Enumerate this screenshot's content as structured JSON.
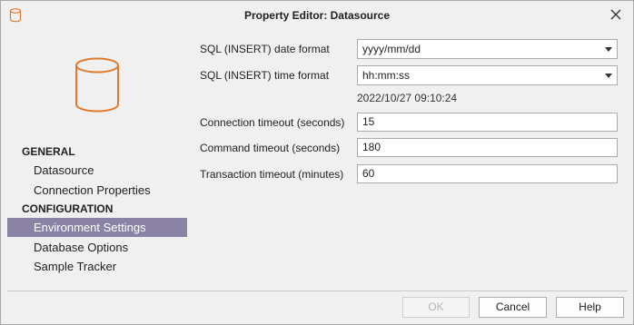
{
  "window": {
    "title": "Property Editor:  Datasource"
  },
  "nav": {
    "sections": [
      {
        "header": "GENERAL",
        "items": [
          "Datasource",
          "Connection Properties"
        ]
      },
      {
        "header": "CONFIGURATION",
        "items": [
          "Environment Settings",
          "Database Options",
          "Sample Tracker"
        ]
      }
    ],
    "selected": "Environment Settings"
  },
  "form": {
    "date_format_label": "SQL (INSERT) date format",
    "date_format_value": "yyyy/mm/dd",
    "time_format_label": "SQL (INSERT) time format",
    "time_format_value": "hh:mm:ss",
    "preview_timestamp": "2022/10/27 09:10:24",
    "connection_timeout_label": "Connection timeout (seconds)",
    "connection_timeout_value": "15",
    "command_timeout_label": "Command timeout (seconds)",
    "command_timeout_value": "180",
    "transaction_timeout_label": "Transaction timeout (minutes)",
    "transaction_timeout_value": "60"
  },
  "buttons": {
    "ok": "OK",
    "cancel": "Cancel",
    "help": "Help"
  },
  "colors": {
    "selection": "#8b83a6",
    "icon_accent": "#e07a2e"
  },
  "icons": {
    "window_icon": "database-icon",
    "big_icon": "database-icon",
    "close": "close-icon"
  }
}
